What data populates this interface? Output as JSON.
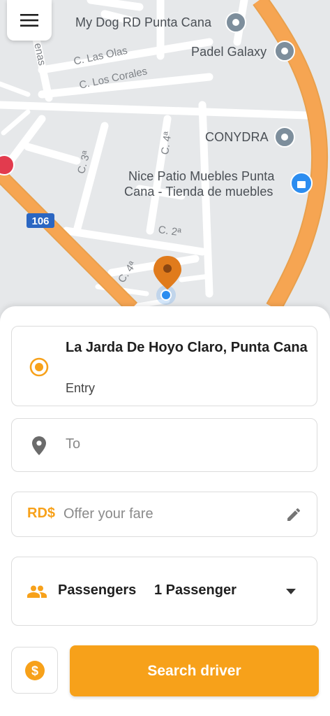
{
  "map": {
    "pois": [
      {
        "name": "My Dog RD Punta Cana"
      },
      {
        "name": "Padel Galaxy"
      },
      {
        "name": "CONYDRA"
      },
      {
        "name": "Nice Patio Muebles Punta Cana - Tienda de muebles"
      }
    ],
    "poi_line1": "Nice Patio Muebles Punta",
    "poi_line2": "Cana - Tienda de muebles",
    "streets": {
      "las_olas": "C. Las Olas",
      "los_corales": "C. Los Corales",
      "c3": "C. 3ª",
      "c4a": "C. 4ª",
      "c2": "C. 2ª",
      "c4b": "C. 4ª",
      "arenas": "enas"
    },
    "highway_shield": "106",
    "colors": {
      "road_major": "#f6a552",
      "background": "#e6e8ea",
      "road_minor": "#ffffff",
      "pin": "#e07b1c"
    }
  },
  "from": {
    "title": "La Jarda De Hoyo Claro, Punta Cana",
    "subtitle": "Entry"
  },
  "to": {
    "placeholder": "To"
  },
  "fare": {
    "currency": "RD$",
    "placeholder": "Offer your fare"
  },
  "passengers": {
    "label": "Passengers",
    "value": "1 Passenger"
  },
  "actions": {
    "search_label": "Search driver"
  },
  "accent_color": "#f7a11a",
  "icons": [
    "menu-icon",
    "map-pin-icon",
    "location-dot-icon",
    "dollar-icon",
    "pencil-icon",
    "people-icon",
    "chevron-down-icon"
  ]
}
